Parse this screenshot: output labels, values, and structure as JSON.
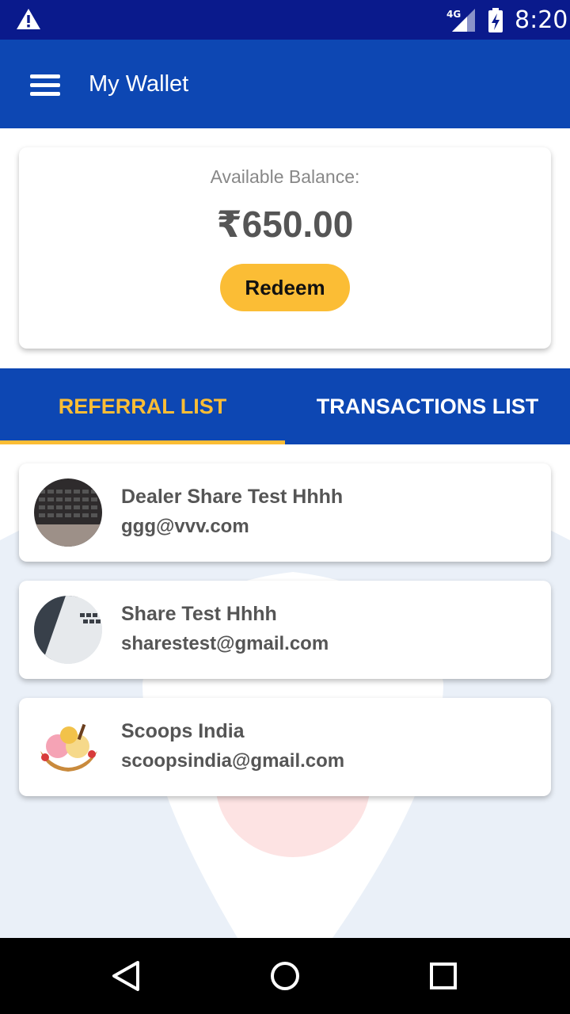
{
  "status_bar": {
    "time": "8:20",
    "network": "4G",
    "icons": [
      "warning-icon",
      "signal-4g-icon",
      "battery-charging-icon"
    ]
  },
  "app_bar": {
    "title": "My Wallet",
    "menu_icon": "hamburger-menu-icon"
  },
  "balance": {
    "label": "Available Balance:",
    "amount": "₹650.00",
    "redeem_label": "Redeem"
  },
  "tabs": [
    {
      "label": "REFERRAL LIST",
      "active": true
    },
    {
      "label": "TRANSACTIONS LIST",
      "active": false
    }
  ],
  "referrals": [
    {
      "name": "Dealer Share Test Hhhh",
      "email": "ggg@vvv.com",
      "avatar": "keyboard-photo"
    },
    {
      "name": "Share Test Hhhh",
      "email": "sharestest@gmail.com",
      "avatar": "laptop-photo"
    },
    {
      "name": "Scoops India",
      "email": "scoopsindia@gmail.com",
      "avatar": "ice-cream-photo"
    }
  ],
  "colors": {
    "status_bar": "#0a1a8c",
    "app_bar": "#0d47b3",
    "accent": "#fbbd35",
    "text": "#555555"
  },
  "nav_bar": {
    "icons": [
      "back-icon",
      "home-icon",
      "recents-icon"
    ]
  }
}
